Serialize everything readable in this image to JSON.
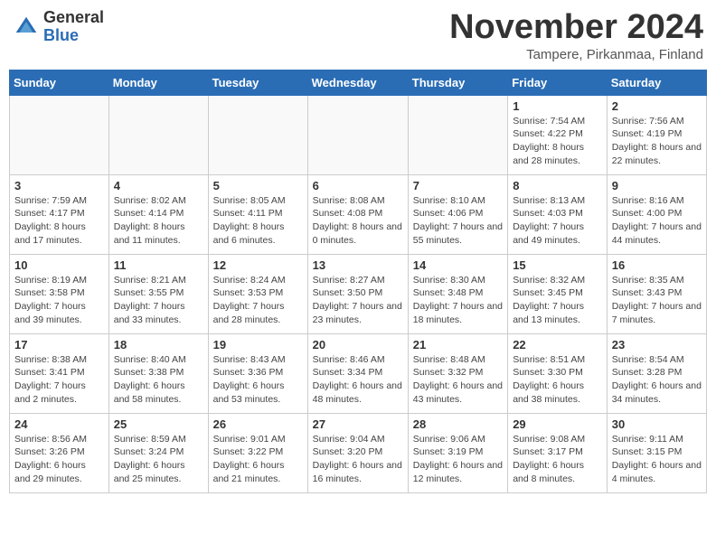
{
  "logo": {
    "general": "General",
    "blue": "Blue"
  },
  "title": "November 2024",
  "subtitle": "Tampere, Pirkanmaa, Finland",
  "days_of_week": [
    "Sunday",
    "Monday",
    "Tuesday",
    "Wednesday",
    "Thursday",
    "Friday",
    "Saturday"
  ],
  "weeks": [
    [
      {
        "day": "",
        "info": ""
      },
      {
        "day": "",
        "info": ""
      },
      {
        "day": "",
        "info": ""
      },
      {
        "day": "",
        "info": ""
      },
      {
        "day": "",
        "info": ""
      },
      {
        "day": "1",
        "info": "Sunrise: 7:54 AM\nSunset: 4:22 PM\nDaylight: 8 hours\nand 28 minutes."
      },
      {
        "day": "2",
        "info": "Sunrise: 7:56 AM\nSunset: 4:19 PM\nDaylight: 8 hours\nand 22 minutes."
      }
    ],
    [
      {
        "day": "3",
        "info": "Sunrise: 7:59 AM\nSunset: 4:17 PM\nDaylight: 8 hours\nand 17 minutes."
      },
      {
        "day": "4",
        "info": "Sunrise: 8:02 AM\nSunset: 4:14 PM\nDaylight: 8 hours\nand 11 minutes."
      },
      {
        "day": "5",
        "info": "Sunrise: 8:05 AM\nSunset: 4:11 PM\nDaylight: 8 hours\nand 6 minutes."
      },
      {
        "day": "6",
        "info": "Sunrise: 8:08 AM\nSunset: 4:08 PM\nDaylight: 8 hours\nand 0 minutes."
      },
      {
        "day": "7",
        "info": "Sunrise: 8:10 AM\nSunset: 4:06 PM\nDaylight: 7 hours\nand 55 minutes."
      },
      {
        "day": "8",
        "info": "Sunrise: 8:13 AM\nSunset: 4:03 PM\nDaylight: 7 hours\nand 49 minutes."
      },
      {
        "day": "9",
        "info": "Sunrise: 8:16 AM\nSunset: 4:00 PM\nDaylight: 7 hours\nand 44 minutes."
      }
    ],
    [
      {
        "day": "10",
        "info": "Sunrise: 8:19 AM\nSunset: 3:58 PM\nDaylight: 7 hours\nand 39 minutes."
      },
      {
        "day": "11",
        "info": "Sunrise: 8:21 AM\nSunset: 3:55 PM\nDaylight: 7 hours\nand 33 minutes."
      },
      {
        "day": "12",
        "info": "Sunrise: 8:24 AM\nSunset: 3:53 PM\nDaylight: 7 hours\nand 28 minutes."
      },
      {
        "day": "13",
        "info": "Sunrise: 8:27 AM\nSunset: 3:50 PM\nDaylight: 7 hours\nand 23 minutes."
      },
      {
        "day": "14",
        "info": "Sunrise: 8:30 AM\nSunset: 3:48 PM\nDaylight: 7 hours\nand 18 minutes."
      },
      {
        "day": "15",
        "info": "Sunrise: 8:32 AM\nSunset: 3:45 PM\nDaylight: 7 hours\nand 13 minutes."
      },
      {
        "day": "16",
        "info": "Sunrise: 8:35 AM\nSunset: 3:43 PM\nDaylight: 7 hours\nand 7 minutes."
      }
    ],
    [
      {
        "day": "17",
        "info": "Sunrise: 8:38 AM\nSunset: 3:41 PM\nDaylight: 7 hours\nand 2 minutes."
      },
      {
        "day": "18",
        "info": "Sunrise: 8:40 AM\nSunset: 3:38 PM\nDaylight: 6 hours\nand 58 minutes."
      },
      {
        "day": "19",
        "info": "Sunrise: 8:43 AM\nSunset: 3:36 PM\nDaylight: 6 hours\nand 53 minutes."
      },
      {
        "day": "20",
        "info": "Sunrise: 8:46 AM\nSunset: 3:34 PM\nDaylight: 6 hours\nand 48 minutes."
      },
      {
        "day": "21",
        "info": "Sunrise: 8:48 AM\nSunset: 3:32 PM\nDaylight: 6 hours\nand 43 minutes."
      },
      {
        "day": "22",
        "info": "Sunrise: 8:51 AM\nSunset: 3:30 PM\nDaylight: 6 hours\nand 38 minutes."
      },
      {
        "day": "23",
        "info": "Sunrise: 8:54 AM\nSunset: 3:28 PM\nDaylight: 6 hours\nand 34 minutes."
      }
    ],
    [
      {
        "day": "24",
        "info": "Sunrise: 8:56 AM\nSunset: 3:26 PM\nDaylight: 6 hours\nand 29 minutes."
      },
      {
        "day": "25",
        "info": "Sunrise: 8:59 AM\nSunset: 3:24 PM\nDaylight: 6 hours\nand 25 minutes."
      },
      {
        "day": "26",
        "info": "Sunrise: 9:01 AM\nSunset: 3:22 PM\nDaylight: 6 hours\nand 21 minutes."
      },
      {
        "day": "27",
        "info": "Sunrise: 9:04 AM\nSunset: 3:20 PM\nDaylight: 6 hours\nand 16 minutes."
      },
      {
        "day": "28",
        "info": "Sunrise: 9:06 AM\nSunset: 3:19 PM\nDaylight: 6 hours\nand 12 minutes."
      },
      {
        "day": "29",
        "info": "Sunrise: 9:08 AM\nSunset: 3:17 PM\nDaylight: 6 hours\nand 8 minutes."
      },
      {
        "day": "30",
        "info": "Sunrise: 9:11 AM\nSunset: 3:15 PM\nDaylight: 6 hours\nand 4 minutes."
      }
    ]
  ]
}
